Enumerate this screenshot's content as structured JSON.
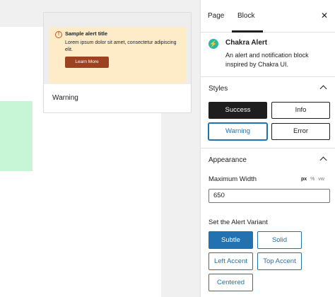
{
  "preview": {
    "alert_title": "Sample alert title",
    "alert_desc": "Lorem ipsum dolor sit amet, consectetur adipiscing elit.",
    "alert_button": "Learn More",
    "label": "Warning"
  },
  "sidebar": {
    "tabs": {
      "page": "Page",
      "block": "Block"
    },
    "close": "✕",
    "block": {
      "icon": "⚡",
      "title": "Chakra Alert",
      "desc": "An alert and notification block inspired by Chakra UI."
    },
    "styles": {
      "title": "Styles",
      "buttons": [
        "Success",
        "Info",
        "Warning",
        "Error"
      ]
    },
    "appearance": {
      "title": "Appearance",
      "max_width_label": "Maximum Width",
      "units": [
        "px",
        "%",
        "vw"
      ],
      "max_width_value": "650",
      "variant_label": "Set the Alert Variant",
      "variants": [
        "Subtle",
        "Solid",
        "Left Accent",
        "Top Accent",
        "Centered"
      ]
    }
  },
  "colors": {
    "accent": "#2271b1",
    "success_bg": "#c6f6d5",
    "alert_bg": "#feebc8",
    "alert_button": "#9c4221"
  }
}
